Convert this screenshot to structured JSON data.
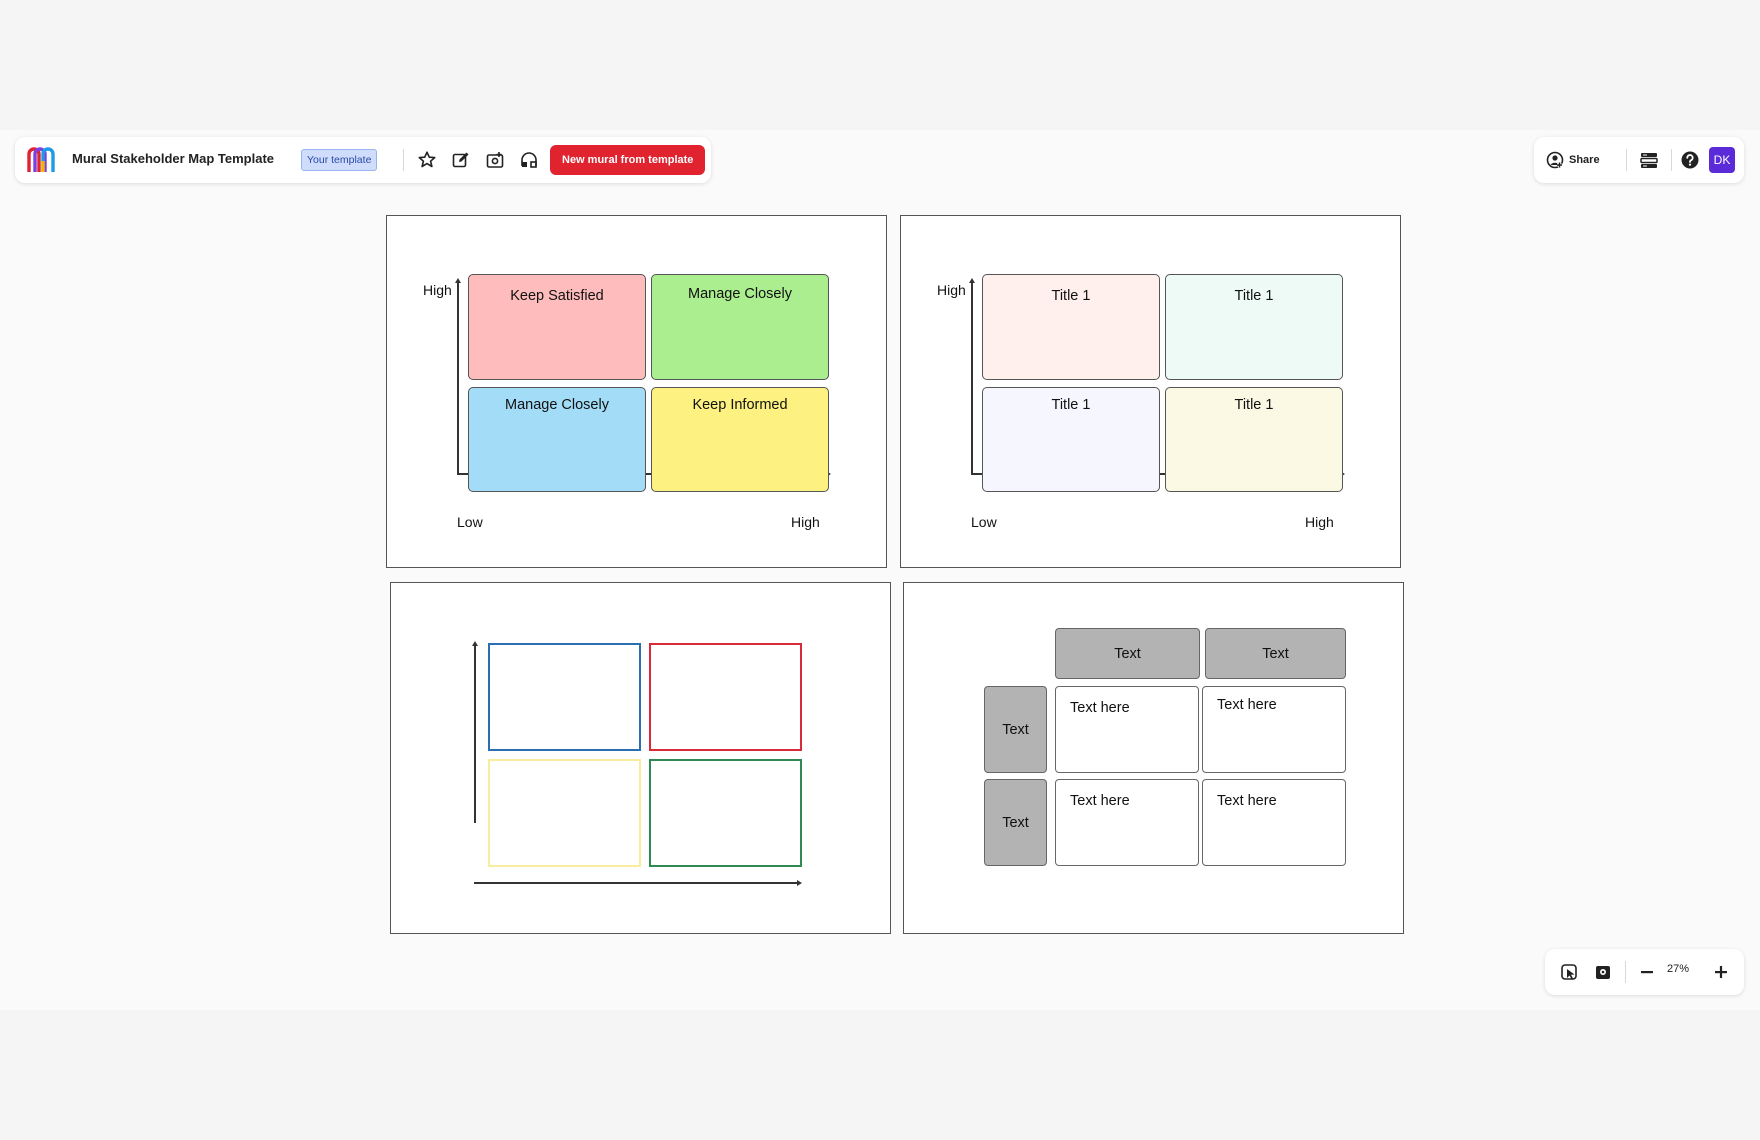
{
  "toolbar": {
    "title": "Mural Stakeholder Map Template",
    "badge": "Your template",
    "tools": [
      "star-icon",
      "edit-icon",
      "import-icon",
      "remix-icon"
    ],
    "new_mural_label": "New mural from template"
  },
  "topright": {
    "share_label": "Share",
    "avatar_initials": "DK",
    "avatar_color": "#5b2bd9"
  },
  "zoom": {
    "level": "27%"
  },
  "frame1": {
    "y_high": "High",
    "x_low": "Low",
    "x_high": "High",
    "quads": [
      {
        "label": "Keep Satisfied",
        "color": "#ffbcbc"
      },
      {
        "label": "Manage Closely",
        "color": "#abee8f"
      },
      {
        "label": "Manage Closely",
        "color": "#a3dcf7"
      },
      {
        "label": "Keep Informed",
        "color": "#fcf181"
      }
    ]
  },
  "frame2": {
    "y_high": "High",
    "x_low": "Low",
    "x_high": "High",
    "quads": [
      {
        "label": "Title 1",
        "color": "#fff0ee"
      },
      {
        "label": "Title 1",
        "color": "#eefaf6"
      },
      {
        "label": "Title 1",
        "color": "#f6f6fe"
      },
      {
        "label": "Title 1",
        "color": "#fbf8e4"
      }
    ]
  },
  "frame3": {
    "colors": [
      "#2a6fb0",
      "#d92a3a",
      "#f7ed9c",
      "#2e8a55"
    ]
  },
  "frame4": {
    "col_heads": [
      "Text",
      "Text"
    ],
    "row_heads": [
      "Text",
      "Text"
    ],
    "cells": [
      "Text here",
      "Text here",
      "Text here",
      "Text here"
    ]
  },
  "colors": {
    "accent_red": "#e0232f",
    "badge_bg": "#cfdcfb"
  }
}
